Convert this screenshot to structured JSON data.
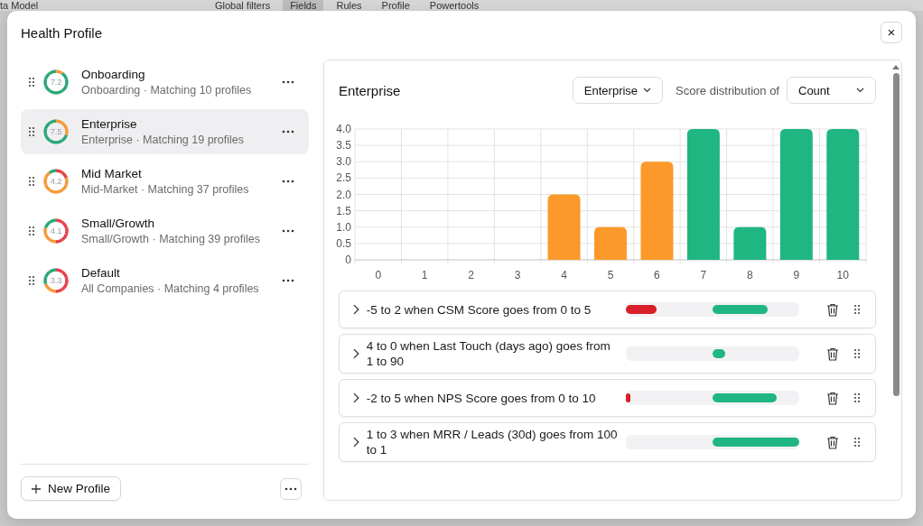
{
  "background": {
    "title": "ta Model",
    "tabs": [
      {
        "label": "Global filters",
        "selected": false
      },
      {
        "label": "Fields",
        "selected": true
      },
      {
        "label": "Rules",
        "selected": false
      },
      {
        "label": "Profile",
        "selected": false
      },
      {
        "label": "Powertools",
        "selected": false
      }
    ]
  },
  "dialog": {
    "title": "Health Profile",
    "close": "×"
  },
  "profiles": [
    {
      "name": "Onboarding",
      "subtitle": "Onboarding · Matching 10 profiles",
      "score": "7.2",
      "selected": false,
      "ring": [
        {
          "color": "#f59a3a"
        },
        {
          "color": "#2aa877"
        },
        {
          "color": "#2aa877"
        },
        {
          "color": "#2aa877"
        },
        {
          "color": "#2aa877"
        },
        {
          "color": "#2aa877"
        },
        {
          "color": "#2aa877"
        },
        {
          "color": "#2aa877"
        },
        {
          "color": "#2aa877"
        },
        {
          "color": "#2aa877"
        }
      ]
    },
    {
      "name": "Enterprise",
      "subtitle": "Enterprise · Matching 19 profiles",
      "score": "7.5",
      "selected": true,
      "ring": [
        {
          "color": "#f59a3a"
        },
        {
          "color": "#f59a3a"
        },
        {
          "color": "#f59a3a"
        },
        {
          "color": "#2aa877"
        },
        {
          "color": "#2aa877"
        },
        {
          "color": "#2aa877"
        },
        {
          "color": "#2aa877"
        },
        {
          "color": "#2aa877"
        },
        {
          "color": "#2aa877"
        },
        {
          "color": "#2aa877"
        }
      ]
    },
    {
      "name": "Mid Market",
      "subtitle": "Mid-Market · Matching 37 profiles",
      "score": "4.2",
      "selected": false,
      "ring": [
        {
          "color": "#e5414b"
        },
        {
          "color": "#e5414b"
        },
        {
          "color": "#f59a3a"
        },
        {
          "color": "#f59a3a"
        },
        {
          "color": "#f59a3a"
        },
        {
          "color": "#f59a3a"
        },
        {
          "color": "#f59a3a"
        },
        {
          "color": "#f59a3a"
        },
        {
          "color": "#f59a3a"
        },
        {
          "color": "#2aa877"
        }
      ]
    },
    {
      "name": "Small/Growth",
      "subtitle": "Small/Growth · Matching 39 profiles",
      "score": "4.1",
      "selected": false,
      "ring": [
        {
          "color": "#e5414b"
        },
        {
          "color": "#e5414b"
        },
        {
          "color": "#e5414b"
        },
        {
          "color": "#e5414b"
        },
        {
          "color": "#e5414b"
        },
        {
          "color": "#f59a3a"
        },
        {
          "color": "#f59a3a"
        },
        {
          "color": "#f59a3a"
        },
        {
          "color": "#2aa877"
        },
        {
          "color": "#2aa877"
        }
      ]
    },
    {
      "name": "Default",
      "subtitle": "All Companies · Matching 4 profiles",
      "score": "3.3",
      "selected": false,
      "ring": [
        {
          "color": "#e5414b"
        },
        {
          "color": "#e5414b"
        },
        {
          "color": "#e5414b"
        },
        {
          "color": "#e5414b"
        },
        {
          "color": "#e5414b"
        },
        {
          "color": "#f59a3a"
        },
        {
          "color": "#f59a3a"
        },
        {
          "color": "#2aa877"
        },
        {
          "color": "#2aa877"
        },
        {
          "color": "#2aa877"
        }
      ]
    }
  ],
  "new_profile_button": "New Profile",
  "detail": {
    "title": "Enterprise",
    "segment_select": "Enterprise",
    "distribution_label": "Score distribution of",
    "distribution_select": "Count",
    "chart_data": {
      "type": "bar",
      "categories": [
        "0",
        "1",
        "2",
        "3",
        "4",
        "5",
        "6",
        "7",
        "8",
        "9",
        "10"
      ],
      "grid": true,
      "ylim": [
        0,
        4
      ],
      "yticks": [
        0,
        {
          "value": 0.5,
          "label": "0.5"
        },
        {
          "value": 1,
          "label": "1.0"
        },
        {
          "value": 1.5,
          "label": "1.5"
        },
        {
          "value": 2,
          "label": "2.0"
        },
        {
          "value": 2.5,
          "label": "2.5"
        },
        {
          "value": 3,
          "label": "3.0"
        },
        {
          "value": 3.5,
          "label": "3.5"
        },
        {
          "value": 4,
          "label": "4.0"
        }
      ],
      "series": [
        {
          "color": "#fb9a2a",
          "values": [
            null,
            null,
            null,
            null,
            2,
            1,
            3,
            null,
            null,
            null,
            null
          ]
        },
        {
          "color": "#20b682",
          "values": [
            null,
            null,
            null,
            null,
            null,
            null,
            null,
            4,
            1,
            4,
            4
          ]
        }
      ]
    },
    "rules": [
      {
        "text": "-5 to 2 when CSM Score goes from 0 to 5",
        "negative": {
          "level": 0.35
        },
        "positive": {
          "level": 0.64
        }
      },
      {
        "text": "4 to 0 when Last Touch (days ago) goes from 1 to 90",
        "positive": {
          "level": 0.15
        }
      },
      {
        "text": "-2 to 5 when NPS Score goes from 0 to 10",
        "negative": {
          "level": 0.05
        },
        "positive": {
          "level": 0.74
        }
      },
      {
        "text": "1 to 3 when MRR / Leads (30d) goes from 100 to 1",
        "positive": {
          "level": 1
        }
      }
    ]
  }
}
